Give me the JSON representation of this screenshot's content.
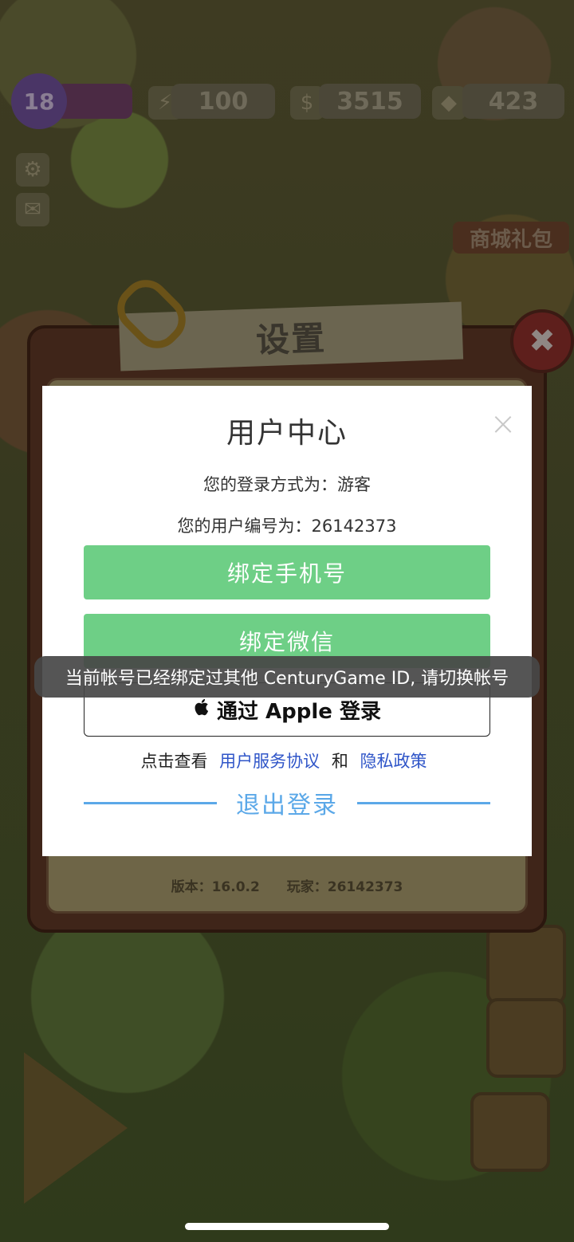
{
  "hud": {
    "level": "18",
    "energy": "100",
    "cash": "3515",
    "gems": "423",
    "shop_label": "商城礼包"
  },
  "settings": {
    "title": "设置",
    "close_symbol": "✖",
    "version_label": "版本：16.0.2",
    "player_label": "玩家：26142373"
  },
  "dialog": {
    "title": "用户中心",
    "close_symbol": "×",
    "login_method": "您的登录方式为：游客",
    "user_id": "您的用户编号为：26142373",
    "bind_phone": "绑定手机号",
    "bind_wechat": "绑定微信",
    "apple_icon": "",
    "apple_login": "通过 Apple 登录",
    "terms_prefix": "点击查看",
    "terms_link": "用户服务协议",
    "terms_and": "和",
    "privacy_link": "隐私政策",
    "logout": "退出登录"
  },
  "toast": {
    "message": "当前帐号已经绑定过其他 CenturyGame ID, 请切换帐号"
  },
  "colors": {
    "green_button": "#6ecf86",
    "link_blue": "#2f55c8",
    "logout_blue": "#5ba8e8"
  }
}
